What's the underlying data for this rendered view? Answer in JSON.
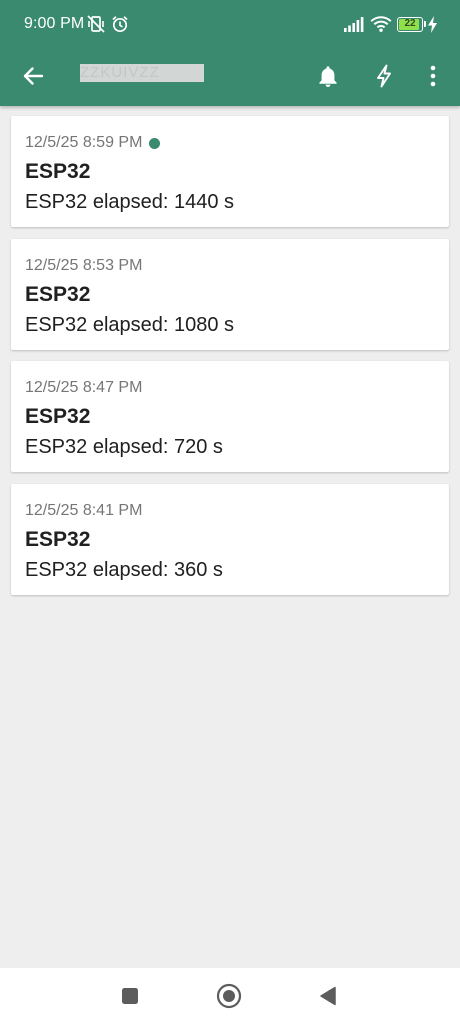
{
  "status_bar": {
    "time": "9:00 PM",
    "battery_level": "22"
  },
  "app_bar": {
    "title": "ZZKUIVZZ",
    "back_icon": "arrow-left-icon",
    "bell_icon": "bell-icon",
    "bolt_icon": "lightning-icon",
    "menu_icon": "more-vert-icon"
  },
  "colors": {
    "primary": "#3a8a70",
    "background": "#eeeeee",
    "card": "#ffffff",
    "text": "#202020",
    "secondary_text": "#767676"
  },
  "notifications": [
    {
      "time": "12/5/25 8:59 PM",
      "title": "ESP32",
      "message": "ESP32 elapsed: 1440 s",
      "unread": true
    },
    {
      "time": "12/5/25 8:53 PM",
      "title": "ESP32",
      "message": "ESP32 elapsed: 1080 s",
      "unread": false
    },
    {
      "time": "12/5/25 8:47 PM",
      "title": "ESP32",
      "message": "ESP32 elapsed: 720 s",
      "unread": false
    },
    {
      "time": "12/5/25 8:41 PM",
      "title": "ESP32",
      "message": "ESP32 elapsed: 360 s",
      "unread": false
    }
  ],
  "nav_bar": {
    "recents_icon": "square-icon",
    "home_icon": "circle-icon",
    "back_icon": "triangle-back-icon"
  }
}
